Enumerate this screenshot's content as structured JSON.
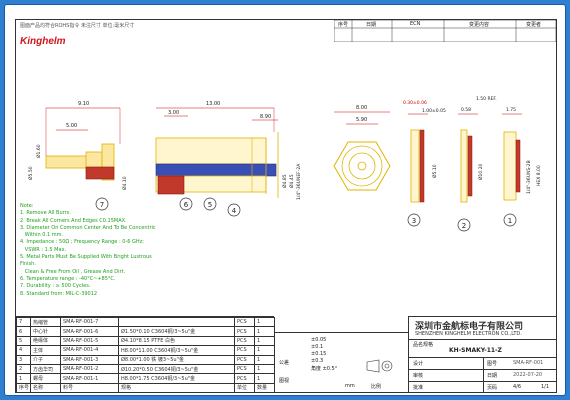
{
  "header": {
    "note": "图面产品均符合ROHS指令 未注尺寸 单位:毫米尺寸"
  },
  "brand": {
    "logo": "Kinghelm",
    "color": "#d0141c"
  },
  "revision_table": {
    "headers": [
      "序号",
      "日期",
      "ECN",
      "变更内容",
      "变更者"
    ]
  },
  "dimensions": {
    "side": {
      "d1": "9.10",
      "d2": "5.00",
      "d3": "13.00",
      "d4": "3.00",
      "d5": "8.90",
      "d6": "Ø1.60",
      "d7": "Ø4.10",
      "d8": "Ø5.50",
      "d9": "Ø4.85",
      "d10": "Ø4.45",
      "d11": "1/4\"-36UNEF-2A"
    },
    "front": {
      "d1": "8.00",
      "d2": "5.90"
    },
    "washers": {
      "d1": "0.30±0.06",
      "d2": "1.00±0.05",
      "d3": "0.58",
      "d4": "1.50 REF.",
      "d5": "1.75",
      "d6": "Ø5.10",
      "d7": "Ø10.20",
      "d8": "1/4\"-36UNS-2B",
      "d9": "HEX 8.00"
    }
  },
  "balloons": [
    "7",
    "6",
    "5",
    "4",
    "3",
    "2",
    "1"
  ],
  "notes": [
    "Note:",
    "1. Remove All Burrs.",
    "2. Break All Corners And Edges C0.15MAX.",
    "3. Diameter On Common Center And To Be Concentric",
    "   Within 0.1 mm.",
    "4. Impedance : 50Ω ; Frequency Range : 0-6 GHz;",
    "   VSWR : 1.5 Max.",
    "5. Metal Parts Must Be Supplied With Bright Lustrous",
    "Finish.",
    "   Clean & Free From Oil , Grease And Dirt.",
    "6. Temperature range : -40°C~+85°C.",
    "7. Durability : ≥ 500 Cycles.",
    "8. Standard from: MIL-C-39012"
  ],
  "bom": [
    {
      "no": "7",
      "name": "热缩管",
      "part": "SMA-RF-001-7",
      "spec": "",
      "unit": "PCS",
      "qty": "1"
    },
    {
      "no": "6",
      "name": "中心针",
      "part": "SMA-RF-001-6",
      "spec": "Ø1.50*0.10 C3604铜/3~5u\"金",
      "unit": "PCS",
      "qty": "1"
    },
    {
      "no": "5",
      "name": "绝缘体",
      "part": "SMA-RF-001-5",
      "spec": "Ø4.10*8.15 PTFE 白色",
      "unit": "PCS",
      "qty": "1"
    },
    {
      "no": "4",
      "name": "主体",
      "part": "SMA-RF-001-4",
      "spec": "H8.00*11.00 C3604铜/3~5u\"金",
      "unit": "PCS",
      "qty": "1"
    },
    {
      "no": "3",
      "name": "介子",
      "part": "SMA-RF-001-3",
      "spec": "Ø8.00*1.00 铁 镀3~5u\"金",
      "unit": "PCS",
      "qty": "1"
    },
    {
      "no": "2",
      "name": "方齿华司",
      "part": "SMA-RF-001-2",
      "spec": "Ø10.20*0.50 C3604铜/3~5u\"金",
      "unit": "PCS",
      "qty": "1"
    },
    {
      "no": "1",
      "name": "螺母",
      "part": "SMA-RF-001-1",
      "spec": "H8.00*1.75 C3604铜/3~5u\"金",
      "unit": "PCS",
      "qty": "1"
    },
    {
      "no": "序号",
      "name": "名称",
      "part": "料号",
      "spec": "规格",
      "unit": "单位",
      "qty": "数量"
    }
  ],
  "tolerance": {
    "label_left": "公差",
    "rows": [
      "±0.05",
      "±0.1",
      "±0.15",
      "±0.3",
      "角度 ±0.5°"
    ],
    "units": "mm",
    "scale": "比例",
    "angle_label": "图视"
  },
  "title_block": {
    "company_cn": "深圳市金航标电子有限公司",
    "company_en": "SHENZHEN KINGHELM ELECTRON CO.,LTD.",
    "model_label": "品名规格",
    "model": "KH-SMAKY-11-Z",
    "rows": [
      {
        "k": "设计",
        "v": "",
        "k2": "图号",
        "v2": "SMA-RF-001"
      },
      {
        "k": "审核",
        "v": "",
        "k2": "日期",
        "v2": "2022-07-20"
      },
      {
        "k": "批准",
        "v": "",
        "k2": "页码",
        "v2": "4/6"
      }
    ],
    "sheet": "1/1"
  }
}
